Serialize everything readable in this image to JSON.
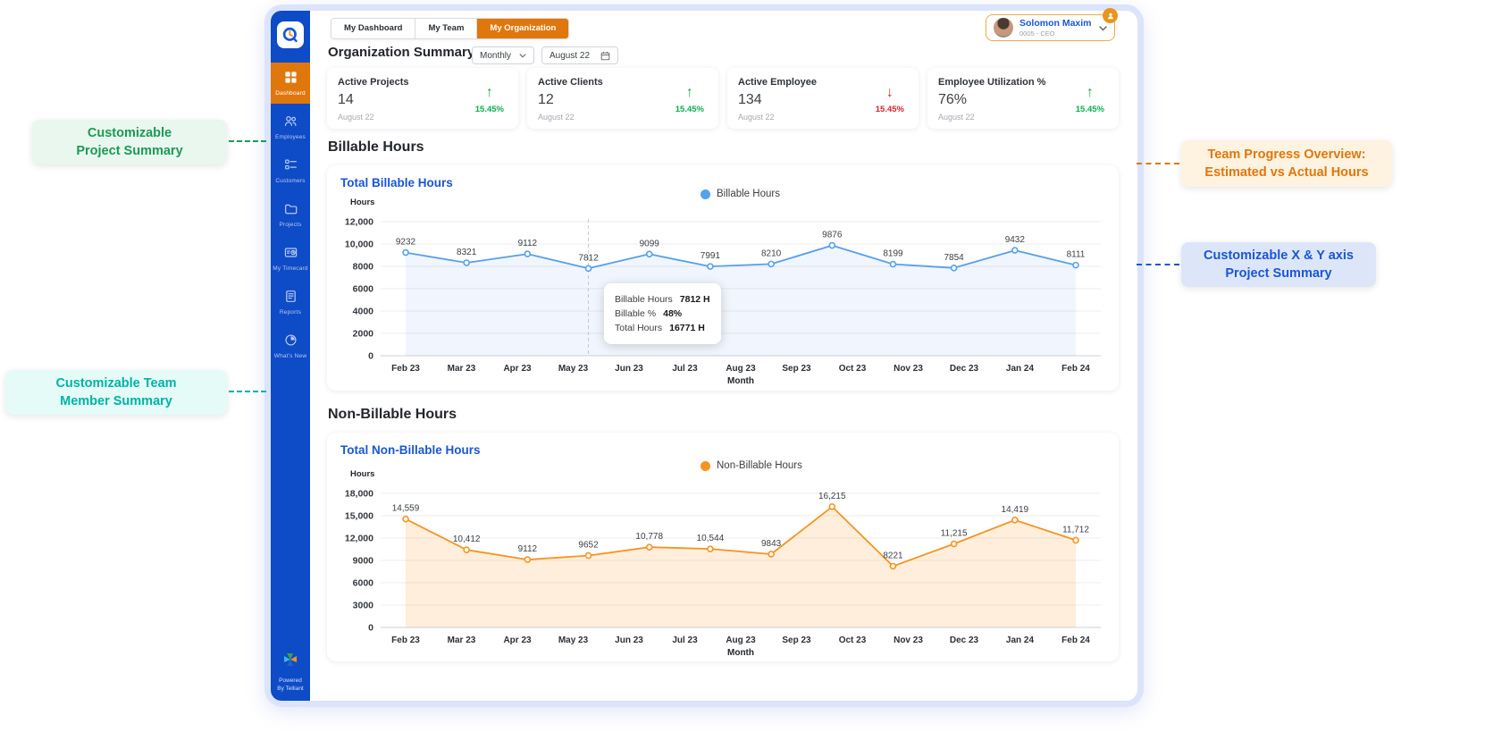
{
  "colors": {
    "sidebar_bg": "#0e4bc6",
    "active_orange": "#e0770c",
    "link_blue": "#1a56d6",
    "trend_up": "#0fae4e",
    "trend_down": "#cf2b2b"
  },
  "sidebar": {
    "logo": "Q-clock-logo",
    "items": [
      {
        "label": "Dashboard",
        "icon": "dashboard-icon",
        "active": true
      },
      {
        "label": "Employees",
        "icon": "employees-icon",
        "active": false
      },
      {
        "label": "Customers",
        "icon": "customers-icon",
        "active": false
      },
      {
        "label": "Projects",
        "icon": "projects-icon",
        "active": false
      },
      {
        "label": "My Timecard",
        "icon": "timecard-icon",
        "active": false
      },
      {
        "label": "Reports",
        "icon": "reports-icon",
        "active": false
      },
      {
        "label": "What's New",
        "icon": "whats-new-icon",
        "active": false
      }
    ],
    "footer": "Powered\nBy Telliant"
  },
  "topbar": {
    "tabs": [
      {
        "label": "My Dashboard",
        "active": false
      },
      {
        "label": "My Team",
        "active": false
      },
      {
        "label": "My Organization",
        "active": true
      }
    ],
    "profile": {
      "name": "Solomon Maxim",
      "meta": "0005 - CEO"
    }
  },
  "summary": {
    "heading": "Organization Summary",
    "period_select": "Monthly",
    "date_value": "August 22",
    "cards": [
      {
        "title": "Active Projects",
        "value": "14",
        "date": "August 22",
        "delta": "15.45%",
        "direction": "up"
      },
      {
        "title": "Active Clients",
        "value": "12",
        "date": "August 22",
        "delta": "15.45%",
        "direction": "up"
      },
      {
        "title": "Active Employee",
        "value": "134",
        "date": "August 22",
        "delta": "15.45%",
        "direction": "down"
      },
      {
        "title": "Employee Utilization %",
        "value": "76%",
        "date": "August 22",
        "delta": "15.45%",
        "direction": "up"
      }
    ]
  },
  "sections": {
    "billable": "Billable Hours",
    "nonbillable": "Non-Billable Hours"
  },
  "chart_data": [
    {
      "type": "line",
      "title": "Total Billable Hours",
      "legend": "Billable Hours",
      "ylabel": "Hours",
      "xlabel": "Month",
      "color": "#55a1ec",
      "fill": "rgba(120,160,235,0.10)",
      "categories": [
        "Feb 23",
        "Mar 23",
        "Apr 23",
        "May 23",
        "Jun 23",
        "Jul 23",
        "Aug 23",
        "Sep 23",
        "Oct 23",
        "Nov 23",
        "Dec 23",
        "Jan 24",
        "Feb 24"
      ],
      "values": [
        9232,
        8321,
        9112,
        7812,
        9099,
        7991,
        8210,
        9876,
        8199,
        7854,
        9432,
        8111
      ],
      "value_labels": [
        "9232",
        "8321",
        "9112",
        "7812",
        "9099",
        "7991",
        "8210",
        "9876",
        "8199",
        "7854",
        "9432",
        "8111"
      ],
      "ymax": 12000,
      "ylim": [
        0,
        12000
      ],
      "ytick_values": [
        12000,
        10000,
        8000,
        6000,
        4000,
        2000,
        0
      ],
      "ytick_labels": [
        "12,000",
        "10,000",
        "8000",
        "6000",
        "4000",
        "2000",
        "0"
      ],
      "grid": true,
      "legend_position": "top-center",
      "highlight_index": 3,
      "tooltip": {
        "rows": [
          {
            "label": "Billable Hours",
            "value": "7812 H"
          },
          {
            "label": "Billable %",
            "value": "48%"
          },
          {
            "label": "Total Hours",
            "value": "16771 H"
          }
        ]
      }
    },
    {
      "type": "area",
      "title": "Total Non-Billable Hours",
      "legend": "Non-Billable Hours",
      "ylabel": "Hours",
      "xlabel": "Month",
      "color": "#f79321",
      "fill": "rgba(247,147,33,0.16)",
      "categories": [
        "Feb 23",
        "Mar 23",
        "Apr 23",
        "May 23",
        "Jun 23",
        "Jul 23",
        "Aug 23",
        "Sep 23",
        "Oct 23",
        "Nov 23",
        "Dec 23",
        "Jan 24",
        "Feb 24"
      ],
      "values": [
        14559,
        10412,
        9112,
        9652,
        10778,
        10544,
        9843,
        16215,
        8221,
        11215,
        14419,
        11712
      ],
      "value_labels": [
        "14,559",
        "10,412",
        "9112",
        "9652",
        "10,778",
        "10,544",
        "9843",
        "16,215",
        "8221",
        "11,215",
        "14,419",
        "11,712"
      ],
      "ymax": 18000,
      "ylim": [
        0,
        18000
      ],
      "ytick_values": [
        18000,
        15000,
        12000,
        9000,
        6000,
        3000,
        0
      ],
      "ytick_labels": [
        "18,000",
        "15,000",
        "12,000",
        "9000",
        "6000",
        "3000",
        "0"
      ],
      "grid": true,
      "legend_position": "top-center",
      "highlight_index": null
    }
  ],
  "annotations": [
    {
      "id": "project-summary",
      "text": "Customizable\nProject Summary",
      "color": "#1b9a55",
      "bg": "#e9f7ee"
    },
    {
      "id": "team-progress",
      "text": "Team Progress Overview:\nEstimated vs Actual Hours",
      "color": "#e0770c",
      "bg": "#fdf3e0"
    },
    {
      "id": "xy-axis",
      "text": "Customizable X & Y axis\nProject Summary",
      "color": "#1a56d6",
      "bg": "#dde6f9"
    },
    {
      "id": "team-member",
      "text": "Customizable Team\nMember Summary",
      "color": "#00b3a6",
      "bg": "#e4fbf8"
    }
  ]
}
